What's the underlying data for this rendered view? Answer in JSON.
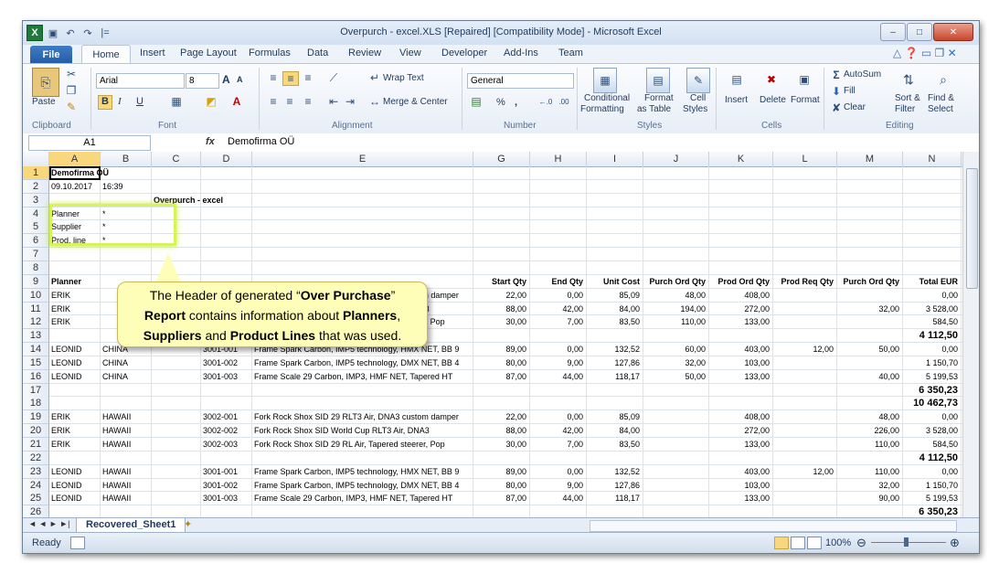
{
  "window": {
    "title": "Overpurch - excel.XLS [Repaired]  [Compatibility Mode]  -  Microsoft Excel",
    "minimize": "–",
    "maximize": "□",
    "close": "✕"
  },
  "qat": {
    "logo": "X",
    "save": "💾",
    "undo": "↶",
    "redo": "↷",
    "more": "|="
  },
  "tabs": [
    "File",
    "Home",
    "Insert",
    "Page Layout",
    "Formulas",
    "Data",
    "Review",
    "View",
    "Developer",
    "Add-Ins",
    "Team"
  ],
  "ribbon": {
    "clipboard": {
      "paste": "Paste",
      "label": "Clipboard"
    },
    "font": {
      "name": "Arial",
      "size": "8",
      "label": "Font",
      "bold": "B",
      "italic": "I",
      "underline": "U",
      "grow": "A",
      "shrink": "A"
    },
    "alignment": {
      "wrap": "Wrap Text",
      "merge": "Merge & Center",
      "label": "Alignment"
    },
    "number": {
      "format": "General",
      "percent": "%",
      "comma": ",",
      "label": "Number"
    },
    "styles": {
      "conditional": "Conditional",
      "conditional2": "Formatting",
      "format_table": "Format",
      "format_table2": "as Table",
      "cell_styles": "Cell",
      "cell_styles2": "Styles",
      "label": "Styles"
    },
    "cells": {
      "insert": "Insert",
      "delete": "Delete",
      "format": "Format",
      "label": "Cells"
    },
    "editing": {
      "autosum": "AutoSum",
      "fill": "Fill",
      "clear": "Clear",
      "sort": "Sort &",
      "sort2": "Filter",
      "find": "Find &",
      "find2": "Select",
      "label": "Editing"
    }
  },
  "formula_bar": {
    "name_box": "A1",
    "fx": "fx",
    "value": "Demofirma OÜ"
  },
  "columns": [
    "A",
    "B",
    "C",
    "D",
    "E",
    "F",
    "G",
    "H",
    "I",
    "J",
    "K",
    "L",
    "M",
    "N"
  ],
  "rows": [
    {
      "n": "1",
      "A": "Demofirma OÜ"
    },
    {
      "n": "2",
      "A": "09.10.2017",
      "B": "16:39"
    },
    {
      "n": "3",
      "C": "Overpurch - excel"
    },
    {
      "n": "4",
      "A": "Planner",
      "B": "*"
    },
    {
      "n": "5",
      "A": "Supplier",
      "B": "*"
    },
    {
      "n": "6",
      "A": "Prod. line",
      "B": "*"
    },
    {
      "n": "7"
    },
    {
      "n": "8"
    },
    {
      "n": "9",
      "A": "Planner",
      "G": "Start Qty",
      "H": "End Qty",
      "I": "Unit Cost",
      "J": "Purch Ord Qty",
      "K": "Prod Ord Qty",
      "L": "Prod Req Qty",
      "M": "Purch Ord Qty",
      "N": "Total EUR"
    },
    {
      "n": "10",
      "A": "ERIK",
      "E": "Fork Rock Shox SID 29 RLT3 Air, DNA3 custom damper",
      "G": "22,00",
      "H": "0,00",
      "I": "85,09",
      "J": "48,00",
      "K": "408,00",
      "N": "0,00"
    },
    {
      "n": "11",
      "A": "ERIK",
      "E": "Fork Rock Shox SID World Cup RLT3 Air, DNA3",
      "G": "88,00",
      "H": "42,00",
      "I": "84,00",
      "J": "194,00",
      "K": "272,00",
      "M": "32,00",
      "N": "3 528,00"
    },
    {
      "n": "12",
      "A": "ERIK",
      "E": "Fork Rock Shox SID 29 RL Air, Tapered steerer, Pop",
      "G": "30,00",
      "H": "7,00",
      "I": "83,50",
      "J": "110,00",
      "K": "133,00",
      "N": "584,50"
    },
    {
      "n": "13",
      "N": "4 112,50"
    },
    {
      "n": "14",
      "A": "LEONID",
      "B": "CHINA",
      "D": "3001-001",
      "E": "Frame Spark Carbon, IMP5 technology, HMX NET, BB 9",
      "G": "89,00",
      "H": "0,00",
      "I": "132,52",
      "J": "60,00",
      "K": "403,00",
      "L": "12,00",
      "M": "50,00",
      "N": "0,00"
    },
    {
      "n": "15",
      "A": "LEONID",
      "B": "CHINA",
      "D": "3001-002",
      "E": "Frame Spark Carbon, IMP5 technology, DMX NET, BB 4",
      "G": "80,00",
      "H": "9,00",
      "I": "127,86",
      "J": "32,00",
      "K": "103,00",
      "N": "1 150,70"
    },
    {
      "n": "16",
      "A": "LEONID",
      "B": "CHINA",
      "D": "3001-003",
      "E": "Frame Scale 29 Carbon, IMP3, HMF NET, Tapered HT",
      "G": "87,00",
      "H": "44,00",
      "I": "118,17",
      "J": "50,00",
      "K": "133,00",
      "M": "40,00",
      "N": "5 199,53"
    },
    {
      "n": "17",
      "N": "6 350,23"
    },
    {
      "n": "18",
      "N": "10 462,73"
    },
    {
      "n": "19",
      "A": "ERIK",
      "B": "HAWAII",
      "D": "3002-001",
      "E": "Fork Rock Shox SID 29 RLT3 Air, DNA3 custom damper",
      "G": "22,00",
      "H": "0,00",
      "I": "85,09",
      "K": "408,00",
      "M": "48,00",
      "N": "0,00"
    },
    {
      "n": "20",
      "A": "ERIK",
      "B": "HAWAII",
      "D": "3002-002",
      "E": "Fork Rock Shox SID World Cup RLT3 Air, DNA3",
      "G": "88,00",
      "H": "42,00",
      "I": "84,00",
      "K": "272,00",
      "M": "226,00",
      "N": "3 528,00"
    },
    {
      "n": "21",
      "A": "ERIK",
      "B": "HAWAII",
      "D": "3002-003",
      "E": "Fork Rock Shox SID 29 RL Air, Tapered steerer, Pop",
      "G": "30,00",
      "H": "7,00",
      "I": "83,50",
      "K": "133,00",
      "M": "110,00",
      "N": "584,50"
    },
    {
      "n": "22",
      "N": "4 112,50"
    },
    {
      "n": "23",
      "A": "LEONID",
      "B": "HAWAII",
      "D": "3001-001",
      "E": "Frame Spark Carbon, IMP5 technology, HMX NET, BB 9",
      "G": "89,00",
      "H": "0,00",
      "I": "132,52",
      "K": "403,00",
      "L": "12,00",
      "M": "110,00",
      "N": "0,00"
    },
    {
      "n": "24",
      "A": "LEONID",
      "B": "HAWAII",
      "D": "3001-002",
      "E": "Frame Spark Carbon, IMP5 technology, DMX NET, BB 4",
      "G": "80,00",
      "H": "9,00",
      "I": "127,86",
      "K": "103,00",
      "M": "32,00",
      "N": "1 150,70"
    },
    {
      "n": "25",
      "A": "LEONID",
      "B": "HAWAII",
      "D": "3001-003",
      "E": "Frame Scale 29 Carbon, IMP3, HMF NET, Tapered HT",
      "G": "87,00",
      "H": "44,00",
      "I": "118,17",
      "K": "133,00",
      "M": "90,00",
      "N": "5 199,53"
    },
    {
      "n": "26",
      "N": "6 350,23"
    }
  ],
  "callout": {
    "l1a": "The Header of generated “",
    "l1b": "Over Purchase",
    "l1c": "”",
    "l2a": "Report",
    "l2b": " contains information about ",
    "l2c": "Planners",
    "l2d": ",",
    "l3a": "Suppliers",
    "l3b": " and ",
    "l3c": "Product Lines",
    "l3d": " that was used."
  },
  "sheet": {
    "tab": "Recovered_Sheet1",
    "nav": "◄ ◄ ► ►|"
  },
  "status": {
    "ready": "Ready",
    "zoom": "100%"
  }
}
